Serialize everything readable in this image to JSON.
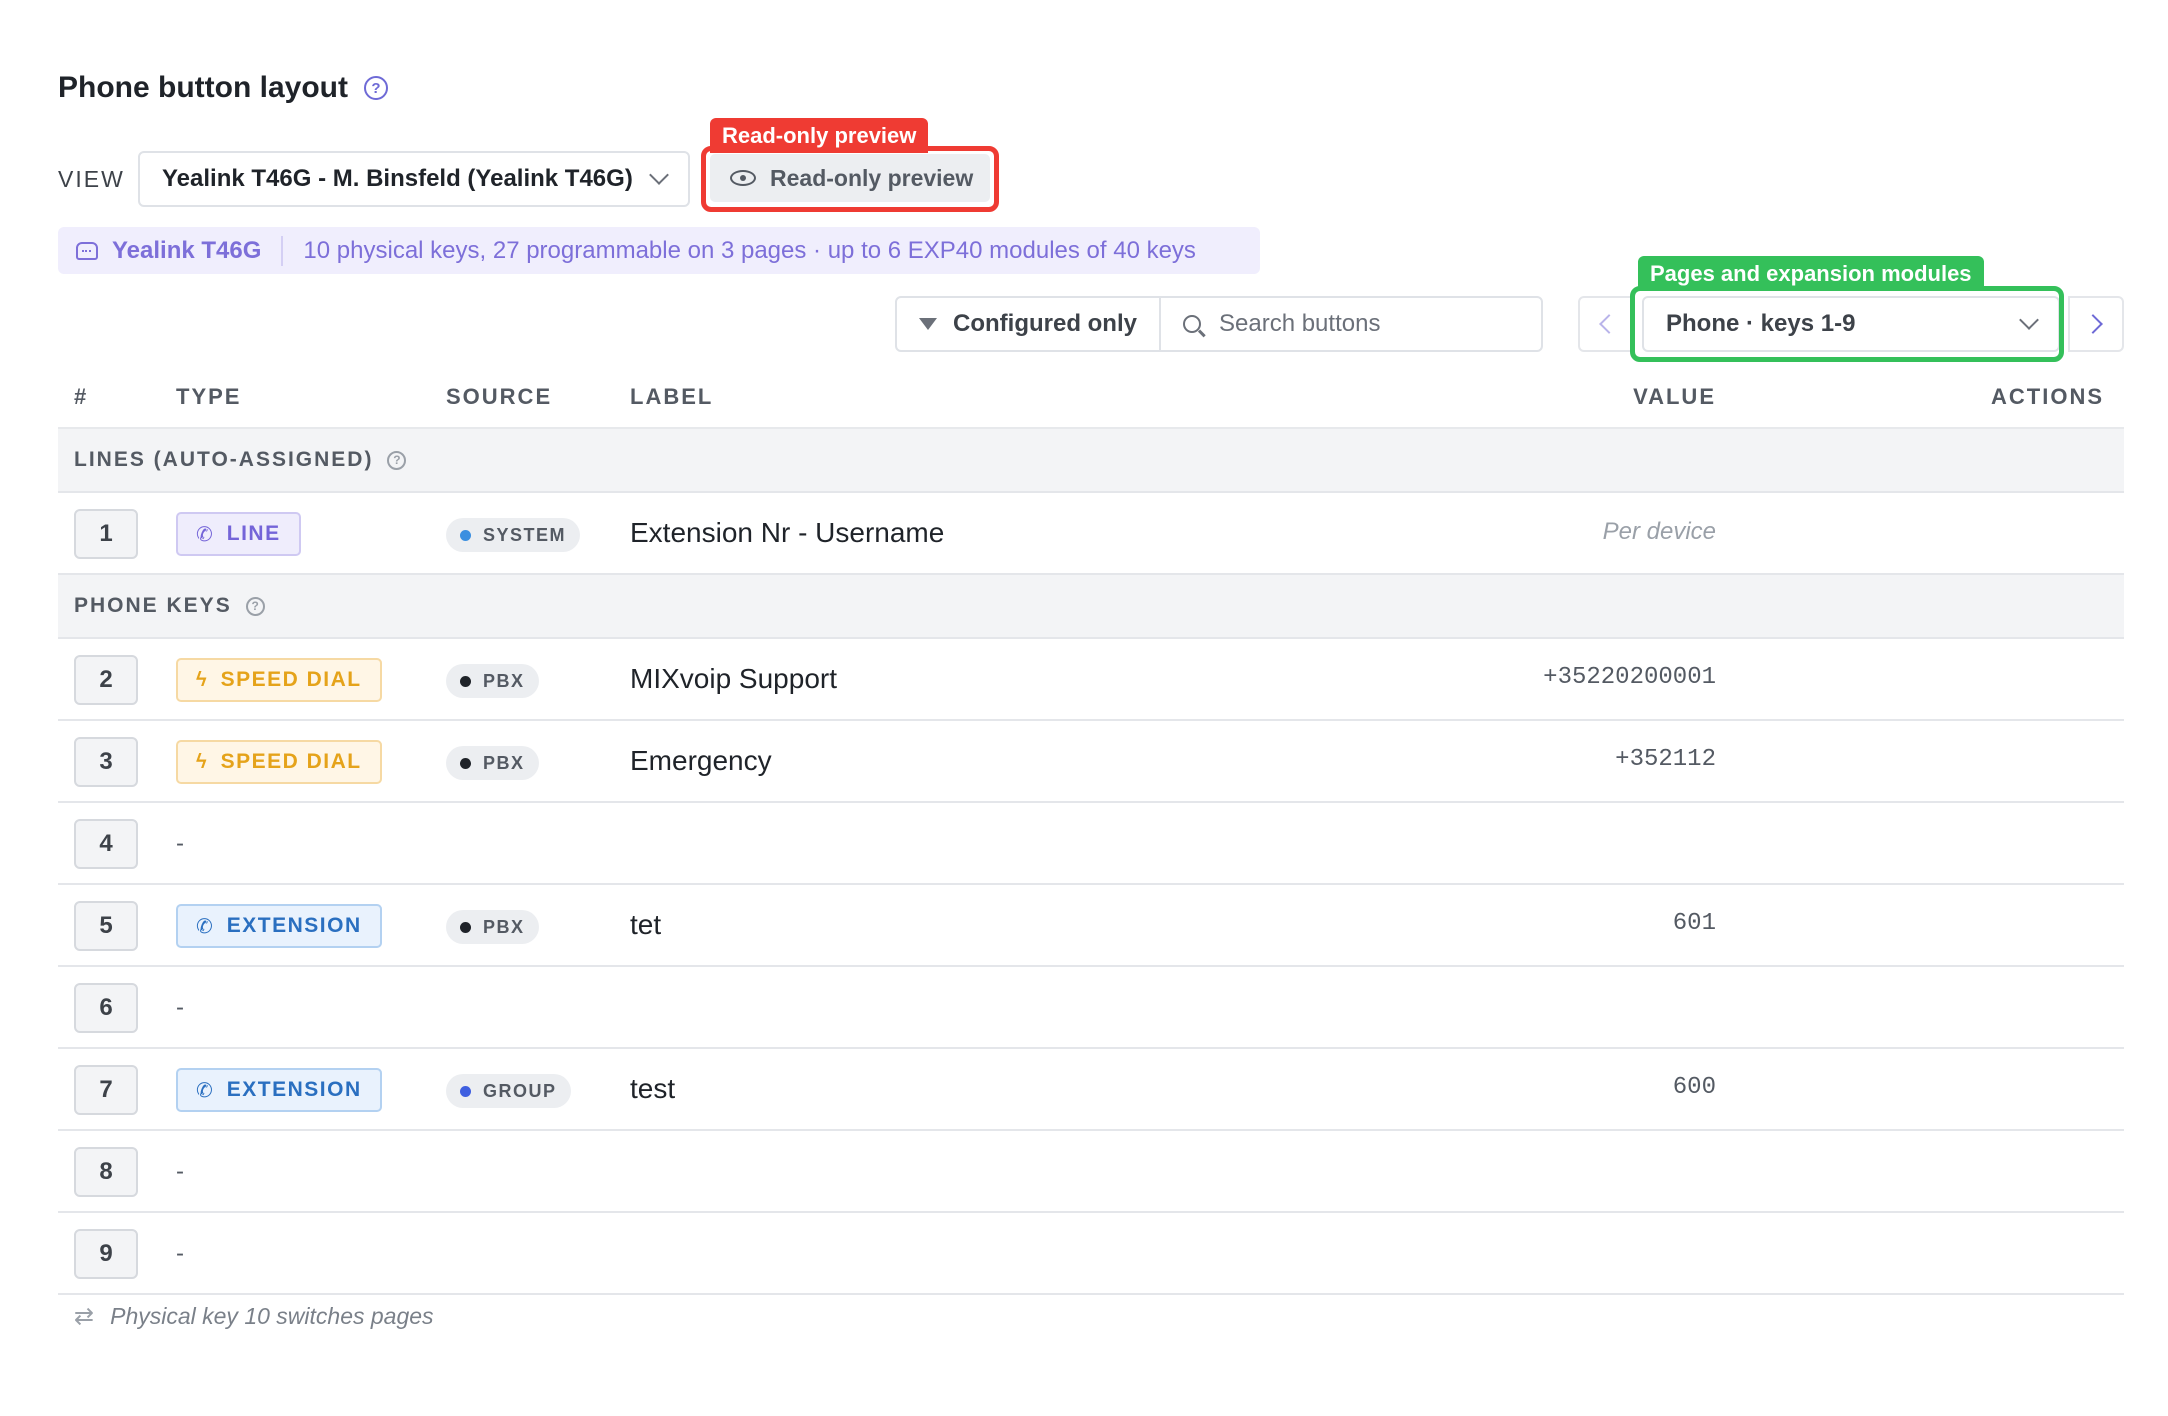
{
  "header": {
    "title": "Phone button layout",
    "view_label": "VIEW",
    "view_value": "Yealink T46G - M. Binsfeld (Yealink T46G)",
    "readonly_button": "Read-only preview",
    "readonly_tag": "Read-only preview"
  },
  "device": {
    "name": "Yealink T46G",
    "summary": "10 physical keys, 27 programmable on 3 pages · up to 6 EXP40 modules of 40 keys"
  },
  "toolbar": {
    "filter_label": "Configured only",
    "search_placeholder": "Search buttons",
    "page_select_value": "Phone · keys 1-9",
    "pages_tag": "Pages and expansion modules"
  },
  "table": {
    "columns": {
      "num": "#",
      "type": "TYPE",
      "source": "SOURCE",
      "label": "LABEL",
      "value": "VALUE",
      "actions": "ACTIONS"
    },
    "groups": [
      {
        "title": "LINES (AUTO-ASSIGNED)"
      },
      {
        "title": "PHONE KEYS"
      }
    ],
    "rows": [
      {
        "num": "1",
        "type": "LINE",
        "source": "SYSTEM",
        "label": "Extension Nr - Username",
        "value": "Per device"
      },
      {
        "num": "2",
        "type": "SPEED DIAL",
        "source": "PBX",
        "label": "MIXvoip Support",
        "value": "+35220200001"
      },
      {
        "num": "3",
        "type": "SPEED DIAL",
        "source": "PBX",
        "label": "Emergency",
        "value": "+352112"
      },
      {
        "num": "4",
        "type": "-",
        "source": "",
        "label": "",
        "value": ""
      },
      {
        "num": "5",
        "type": "EXTENSION",
        "source": "PBX",
        "label": "tet",
        "value": "601"
      },
      {
        "num": "6",
        "type": "-",
        "source": "",
        "label": "",
        "value": ""
      },
      {
        "num": "7",
        "type": "EXTENSION",
        "source": "GROUP",
        "label": "test",
        "value": "600"
      },
      {
        "num": "8",
        "type": "-",
        "source": "",
        "label": "",
        "value": ""
      },
      {
        "num": "9",
        "type": "-",
        "source": "",
        "label": "",
        "value": ""
      }
    ]
  },
  "footnote": "Physical key 10 switches pages",
  "colors": {
    "accent": "#6e6ad6",
    "readonly_highlight": "#ef3b33",
    "pages_highlight": "#34c05a",
    "source_system": "#3b8fe0",
    "source_pbx": "#1f2329",
    "source_group": "#3f5fe0"
  }
}
